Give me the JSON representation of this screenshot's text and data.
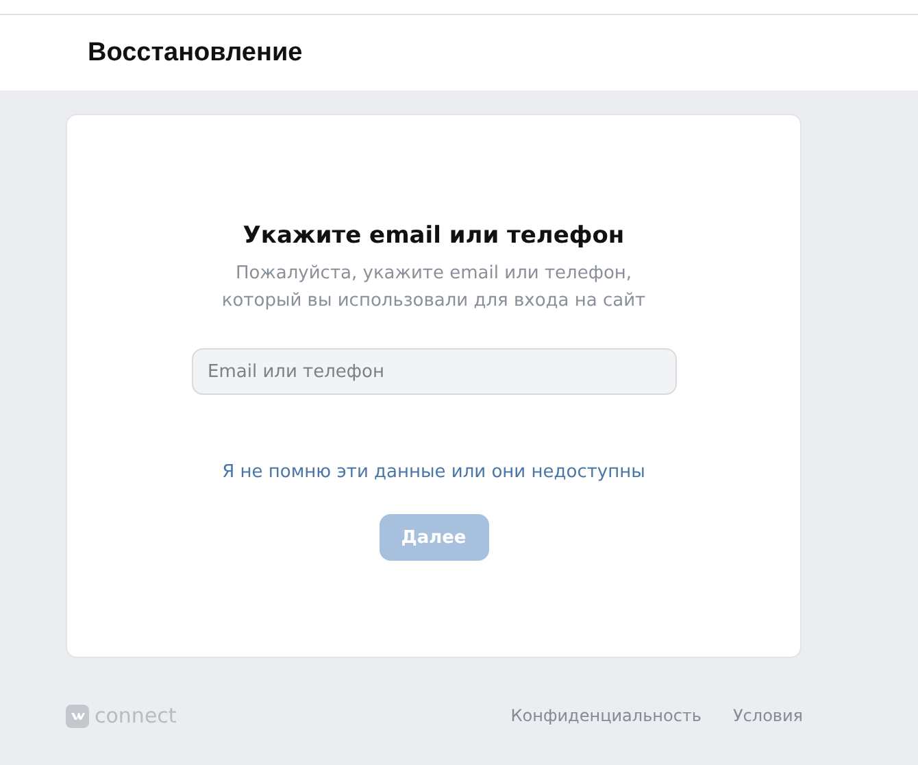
{
  "header": {
    "title": "Восстановление"
  },
  "card": {
    "title": "Укажите email или телефон",
    "subtitle": "Пожалуйста, укажите email или телефон, который вы использовали для входа на сайт",
    "field": {
      "placeholder": "Email или телефон"
    },
    "link": "Я не помню эти данные или они недоступны",
    "button": {
      "label": "Далее",
      "disabled": true
    }
  },
  "footer": {
    "brand": "connect",
    "links": [
      "Конфиденциальность",
      "Условия"
    ]
  }
}
